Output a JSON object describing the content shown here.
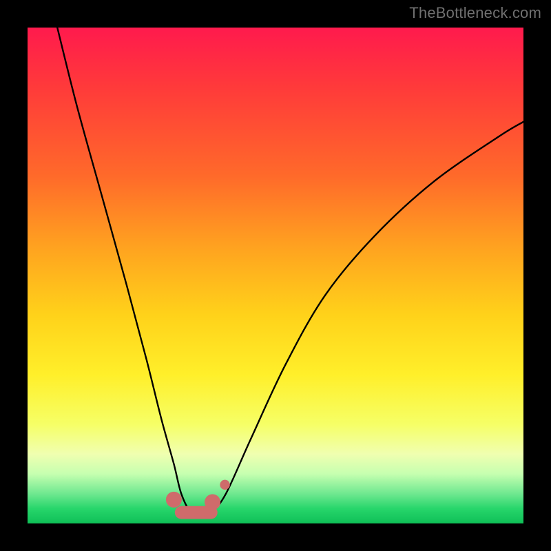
{
  "watermark": "TheBottleneck.com",
  "chart_data": {
    "type": "line",
    "title": "",
    "xlabel": "",
    "ylabel": "",
    "xlim": [
      0,
      100
    ],
    "ylim": [
      0,
      100
    ],
    "series": [
      {
        "name": "bottleneck-curve",
        "x": [
          6,
          10,
          15,
          20,
          24,
          27,
          29.5,
          31,
          33,
          35,
          37,
          40,
          45,
          52,
          60,
          70,
          82,
          95,
          100
        ],
        "y": [
          100,
          84,
          66,
          48,
          33,
          21,
          12,
          6,
          2.2,
          2.0,
          2.2,
          6,
          17,
          32,
          46,
          58,
          69,
          78,
          81
        ]
      }
    ],
    "markers": [
      {
        "name": "trough-left",
        "shape": "round",
        "x": 29.5,
        "y": 4.8,
        "r": 1.6
      },
      {
        "name": "trough-band",
        "shape": "bar",
        "x0": 31,
        "x1": 37,
        "y": 2.2,
        "thickness": 2.6
      },
      {
        "name": "trough-right",
        "shape": "round",
        "x": 37.3,
        "y": 4.3,
        "r": 1.6
      },
      {
        "name": "stray-dot",
        "shape": "dot",
        "x": 39.8,
        "y": 7.8,
        "r": 1.0
      }
    ],
    "colors": {
      "curve": "#000000",
      "markers": "#cf6b6b",
      "gradient_top": "#ff1a4d",
      "gradient_bottom": "#0fbf57"
    }
  }
}
